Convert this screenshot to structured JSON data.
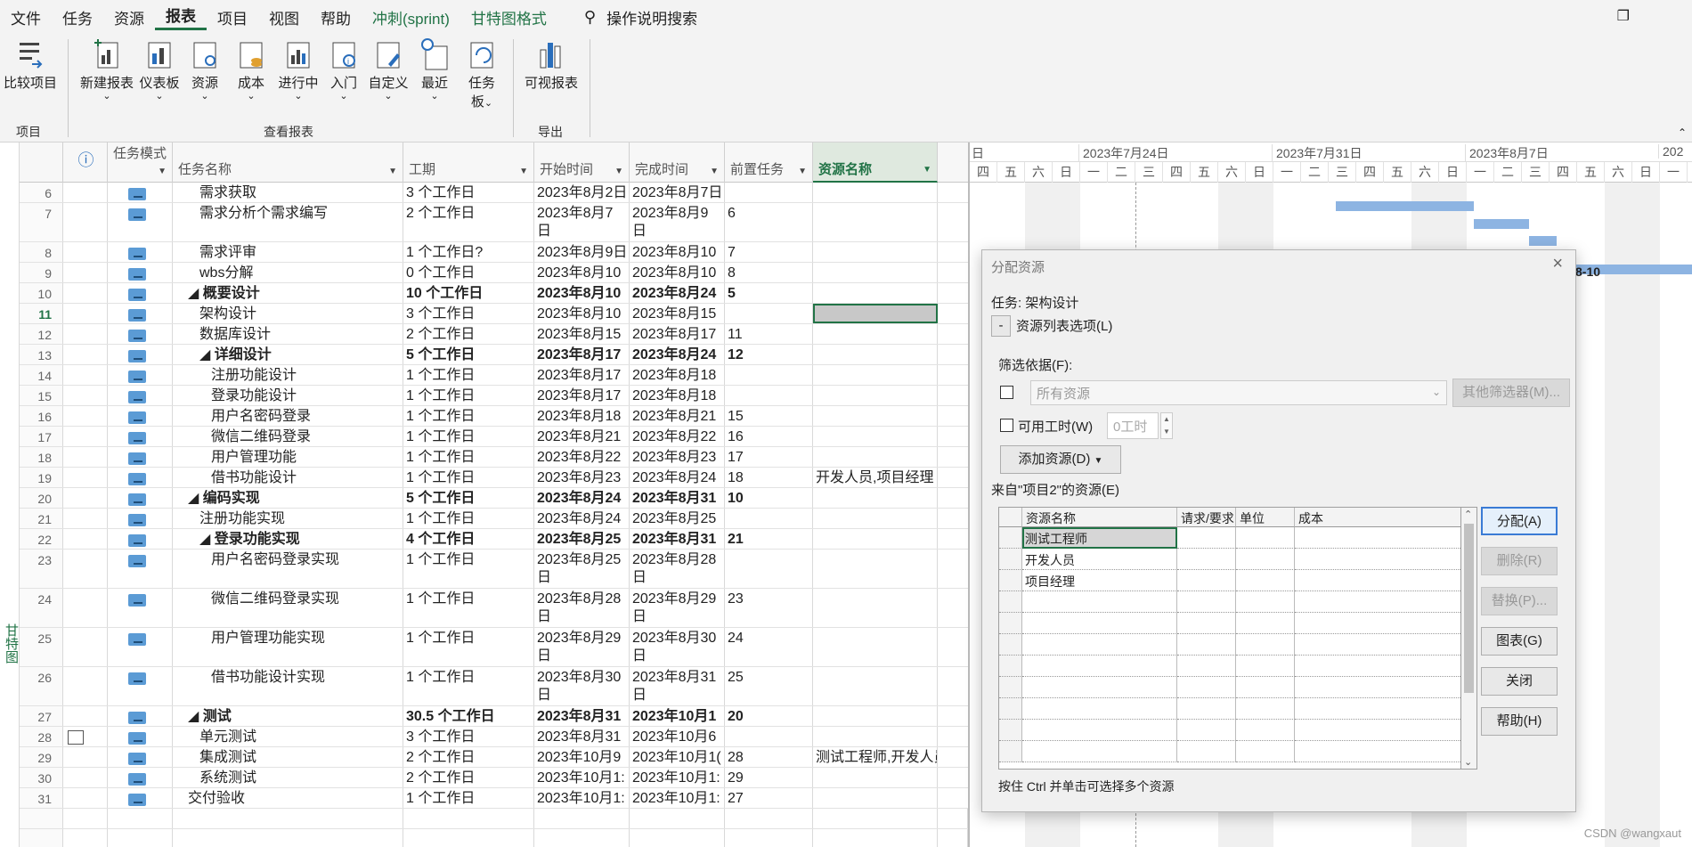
{
  "menu": {
    "items": [
      "文件",
      "任务",
      "资源",
      "报表",
      "项目",
      "视图",
      "帮助"
    ],
    "green_items": [
      "冲刺(sprint)",
      "甘特图格式"
    ],
    "active": "报表",
    "search_placeholder": "操作说明搜索"
  },
  "ribbon": {
    "compare": "比较项目",
    "new_report": "新建报表",
    "dashboard": "仪表板",
    "resources": "资源",
    "cost": "成本",
    "in_progress": "进行中",
    "getting_started": "入门",
    "custom": "自定义",
    "recent": "最近",
    "task_board_1": "任务",
    "task_board_2": "板",
    "visual_reports": "可视报表",
    "group_project": "项目",
    "group_view_reports": "查看报表",
    "group_export": "导出"
  },
  "side_label": "甘特图",
  "table": {
    "headers": {
      "info": "ⓘ",
      "mode": "任务模式",
      "name": "任务名称",
      "duration": "工期",
      "start": "开始时间",
      "finish": "完成时间",
      "pred": "前置任务",
      "resource": "资源名称"
    },
    "rows": [
      {
        "id": "6",
        "name": "需求获取",
        "indent": 2,
        "bold": false,
        "dur": "3 个工作日",
        "start": "2023年8月2日",
        "finish": "2023年8月7日",
        "pred": "",
        "res": "",
        "tall": false
      },
      {
        "id": "7",
        "name": "需求分析个需求编写",
        "indent": 2,
        "bold": false,
        "dur": "2 个工作日",
        "start": "2023年8月7日",
        "finish": "2023年8月9日",
        "pred": "6",
        "res": "",
        "tall": true
      },
      {
        "id": "8",
        "name": "需求评审",
        "indent": 2,
        "bold": false,
        "dur": "1 个工作日?",
        "start": "2023年8月9日",
        "finish": "2023年8月10",
        "pred": "7",
        "res": "",
        "tall": false
      },
      {
        "id": "9",
        "name": "wbs分解",
        "indent": 2,
        "bold": false,
        "dur": "0 个工作日",
        "start": "2023年8月10",
        "finish": "2023年8月10",
        "pred": "8",
        "res": "",
        "tall": false
      },
      {
        "id": "10",
        "name": "◢ 概要设计",
        "indent": 1,
        "bold": true,
        "dur": "10 个工作日",
        "start": "2023年8月10",
        "finish": "2023年8月24",
        "pred": "5",
        "res": "",
        "tall": false
      },
      {
        "id": "11",
        "name": "架构设计",
        "indent": 2,
        "bold": false,
        "dur": "3 个工作日",
        "start": "2023年8月10",
        "finish": "2023年8月15",
        "pred": "",
        "res": "",
        "tall": false,
        "selected": true
      },
      {
        "id": "12",
        "name": "数据库设计",
        "indent": 2,
        "bold": false,
        "dur": "2 个工作日",
        "start": "2023年8月15",
        "finish": "2023年8月17",
        "pred": "11",
        "res": "",
        "tall": false
      },
      {
        "id": "13",
        "name": "◢ 详细设计",
        "indent": 2,
        "bold": true,
        "dur": "5 个工作日",
        "start": "2023年8月17",
        "finish": "2023年8月24",
        "pred": "12",
        "res": "",
        "tall": false
      },
      {
        "id": "14",
        "name": "注册功能设计",
        "indent": 3,
        "bold": false,
        "dur": "1 个工作日",
        "start": "2023年8月17",
        "finish": "2023年8月18",
        "pred": "",
        "res": "",
        "tall": false
      },
      {
        "id": "15",
        "name": "登录功能设计",
        "indent": 3,
        "bold": false,
        "dur": "1 个工作日",
        "start": "2023年8月17",
        "finish": "2023年8月18",
        "pred": "",
        "res": "",
        "tall": false
      },
      {
        "id": "16",
        "name": "用户名密码登录",
        "indent": 3,
        "bold": false,
        "dur": "1 个工作日",
        "start": "2023年8月18",
        "finish": "2023年8月21",
        "pred": "15",
        "res": "",
        "tall": false
      },
      {
        "id": "17",
        "name": "微信二维码登录",
        "indent": 3,
        "bold": false,
        "dur": "1 个工作日",
        "start": "2023年8月21",
        "finish": "2023年8月22",
        "pred": "16",
        "res": "",
        "tall": false
      },
      {
        "id": "18",
        "name": "用户管理功能",
        "indent": 3,
        "bold": false,
        "dur": "1 个工作日",
        "start": "2023年8月22",
        "finish": "2023年8月23",
        "pred": "17",
        "res": "",
        "tall": false
      },
      {
        "id": "19",
        "name": "借书功能设计",
        "indent": 3,
        "bold": false,
        "dur": "1 个工作日",
        "start": "2023年8月23",
        "finish": "2023年8月24",
        "pred": "18",
        "res": "开发人员,项目经理",
        "tall": false
      },
      {
        "id": "20",
        "name": "◢ 编码实现",
        "indent": 1,
        "bold": true,
        "dur": "5 个工作日",
        "start": "2023年8月24",
        "finish": "2023年8月31",
        "pred": "10",
        "res": "",
        "tall": false
      },
      {
        "id": "21",
        "name": "注册功能实现",
        "indent": 2,
        "bold": false,
        "dur": "1 个工作日",
        "start": "2023年8月24",
        "finish": "2023年8月25",
        "pred": "",
        "res": "",
        "tall": false
      },
      {
        "id": "22",
        "name": "◢ 登录功能实现",
        "indent": 2,
        "bold": true,
        "dur": "4 个工作日",
        "start": "2023年8月25",
        "finish": "2023年8月31",
        "pred": "21",
        "res": "",
        "tall": false
      },
      {
        "id": "23",
        "name": "用户名密码登录实现",
        "indent": 3,
        "bold": false,
        "dur": "1 个工作日",
        "start": "2023年8月25日",
        "finish": "2023年8月28日",
        "pred": "",
        "res": "",
        "tall": true
      },
      {
        "id": "24",
        "name": "微信二维码登录实现",
        "indent": 3,
        "bold": false,
        "dur": "1 个工作日",
        "start": "2023年8月28日",
        "finish": "2023年8月29日",
        "pred": "23",
        "res": "",
        "tall": true
      },
      {
        "id": "25",
        "name": "用户管理功能实现",
        "indent": 3,
        "bold": false,
        "dur": "1 个工作日",
        "start": "2023年8月29日",
        "finish": "2023年8月30日",
        "pred": "24",
        "res": "",
        "tall": true
      },
      {
        "id": "26",
        "name": "借书功能设计实现",
        "indent": 3,
        "bold": false,
        "dur": "1 个工作日",
        "start": "2023年8月30日",
        "finish": "2023年8月31日",
        "pred": "25",
        "res": "",
        "tall": true
      },
      {
        "id": "27",
        "name": "◢ 测试",
        "indent": 1,
        "bold": true,
        "dur": "30.5 个工作日",
        "start": "2023年8月31",
        "finish": "2023年10月1",
        "pred": "20",
        "res": "",
        "tall": false
      },
      {
        "id": "28",
        "name": "单元测试",
        "indent": 2,
        "bold": false,
        "dur": "3 个工作日",
        "start": "2023年8月31",
        "finish": "2023年10月6",
        "pred": "",
        "res": "",
        "tall": false,
        "cal": true
      },
      {
        "id": "29",
        "name": "集成测试",
        "indent": 2,
        "bold": false,
        "dur": "2 个工作日",
        "start": "2023年10月9",
        "finish": "2023年10月1(",
        "pred": "28",
        "res": "测试工程师,开发人员",
        "tall": false
      },
      {
        "id": "30",
        "name": "系统测试",
        "indent": 2,
        "bold": false,
        "dur": "2 个工作日",
        "start": "2023年10月1:",
        "finish": "2023年10月1:",
        "pred": "29",
        "res": "",
        "tall": false
      },
      {
        "id": "31",
        "name": "交付验收",
        "indent": 1,
        "bold": false,
        "dur": "1 个工作日",
        "start": "2023年10月1:",
        "finish": "2023年10月1:",
        "pred": "27",
        "res": "",
        "tall": false
      }
    ]
  },
  "gantt": {
    "weeks": [
      "2023年7月24日",
      "2023年7月31日",
      "2023年8月7日",
      "202"
    ],
    "first_week_partial": "日",
    "days": [
      "四",
      "五",
      "六",
      "日",
      "一",
      "二",
      "三",
      "四",
      "五",
      "六",
      "日",
      "一",
      "二",
      "三",
      "四",
      "五",
      "六",
      "日",
      "一",
      "二",
      "三",
      "四",
      "五",
      "六",
      "日",
      "一"
    ],
    "label_8_10": "8-10"
  },
  "dialog": {
    "title": "分配资源",
    "task_label": "任务: 架构设计",
    "toggle": "-",
    "list_options": "资源列表选项(L)",
    "filter_by": "筛选依据(F):",
    "filter_value": "所有资源",
    "more_filters": "其他筛选器(M)...",
    "available_work": "可用工时(W)",
    "work_value": "0工时",
    "add_resources": "添加资源(D)",
    "from_label": "来自\"项目2\"的资源(E)",
    "columns": [
      "资源名称",
      "请求/要求",
      "单位",
      "成本"
    ],
    "resources": [
      "测试工程师",
      "开发人员",
      "项目经理"
    ],
    "buttons": {
      "assign": "分配(A)",
      "remove": "删除(R)",
      "replace": "替换(P)...",
      "graphs": "图表(G)",
      "close": "关闭",
      "help": "帮助(H)"
    },
    "hint": "按住 Ctrl 并单击可选择多个资源"
  },
  "watermark": "CSDN @wangxaut",
  "colors": {
    "accent": "#217346",
    "bar": "#8db4e2",
    "task_icon": "#5b9bd5"
  }
}
